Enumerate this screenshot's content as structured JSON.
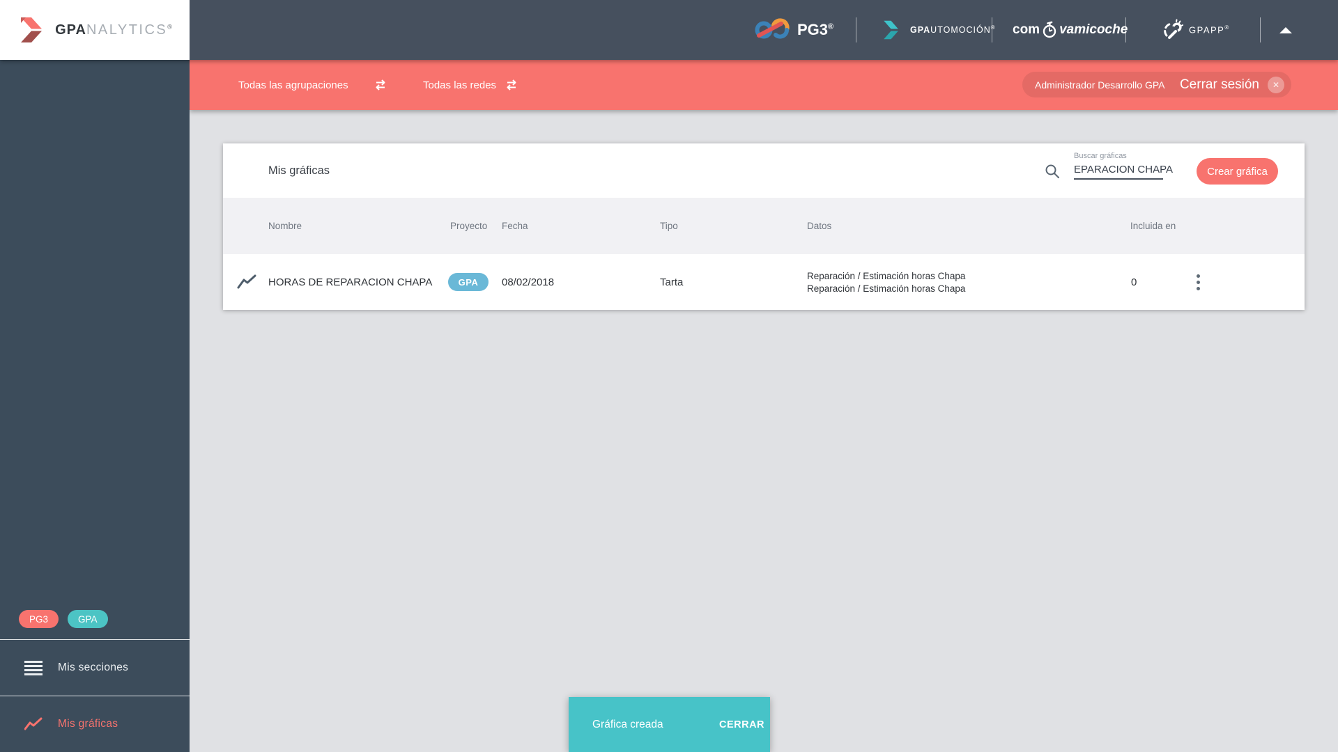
{
  "colors": {
    "accent_red": "#f8736e",
    "accent_teal": "#47c3c8",
    "badge_blue": "#6ab8d7",
    "topbar_bg": "#46505e",
    "sidebar_bg": "#3c4c5b"
  },
  "brand": {
    "name_bold": "GPA",
    "name_light": "NALYTICS",
    "registered": "®"
  },
  "topbar": {
    "pg3_label": "PG3",
    "pg3_sup": "®",
    "gpautomocion_bold": "GPA",
    "gpautomocion_rest": "UTOMOCIÓN",
    "gpautomocion_sup": "®",
    "comprova_left": "com",
    "comprova_right": "vamicoche",
    "gpapp_label": "GPAPP",
    "gpapp_sup": "®"
  },
  "filterbar": {
    "groupings": "Todas las agrupaciones",
    "networks": "Todas las redes",
    "user": "Administrador Desarrollo GPA",
    "logout": "Cerrar sesión"
  },
  "sidebar": {
    "badge_pg3": "PG3",
    "badge_gpa": "GPA",
    "item_sections": "Mis secciones",
    "item_charts": "Mis gráficas"
  },
  "main": {
    "title": "Mis gráficas",
    "search": {
      "label": "Buscar gráficas",
      "value": "EPARACION CHAPA"
    },
    "create_button": "Crear gráfica",
    "table": {
      "headers": [
        "Nombre",
        "Proyecto",
        "Fecha",
        "Tipo",
        "Datos",
        "Incluida en"
      ],
      "rows": [
        {
          "nombre": "HORAS DE REPARACION CHAPA",
          "proyecto_badge": "GPA",
          "fecha": "08/02/2018",
          "tipo": "Tarta",
          "datos": [
            "Reparación / Estimación horas Chapa",
            "Reparación / Estimación horas Chapa"
          ],
          "incluida_en": "0"
        }
      ]
    }
  },
  "toast": {
    "message": "Gráfica creada",
    "action": "CERRAR"
  }
}
